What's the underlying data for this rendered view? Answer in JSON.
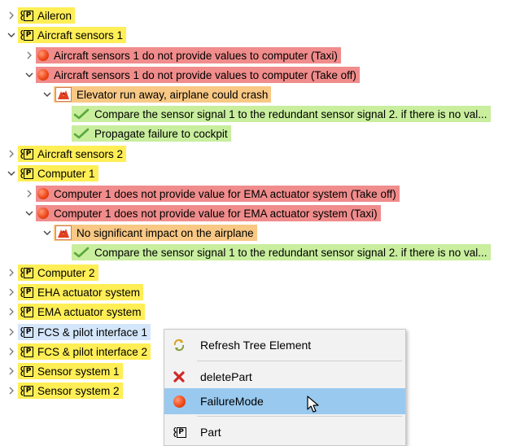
{
  "colors": {
    "part_highlight": "#ffee55",
    "failure_mode_highlight": "#f08c8c",
    "effect_highlight": "#f8c884",
    "measure_highlight": "#c8ee9e",
    "selected_row": "#d4e6fb",
    "menu_selected": "#99c9ef"
  },
  "tree": {
    "aileron": "Aileron",
    "aircraft_sensors_1": "Aircraft sensors 1",
    "as1_fm_taxi": "Aircraft sensors 1 do not provide values to computer (Taxi)",
    "as1_fm_takeoff": "Aircraft sensors 1 do not provide values to computer (Take off)",
    "as1_effect": "Elevator run away, airplane could crash",
    "as1_measure_compare": "Compare the sensor signal 1 to the redundant sensor signal 2. if there is no val...",
    "as1_measure_propagate": "Propagate failure to cockpit",
    "aircraft_sensors_2": "Aircraft sensors 2",
    "computer_1": "Computer 1",
    "c1_fm_takeoff": "Computer 1 does not provide value for EMA actuator system (Take off)",
    "c1_fm_taxi": "Computer 1 does not provide value for EMA actuator system (Taxi)",
    "c1_effect": "No significant impact on the airplane",
    "c1_measure_compare": "Compare the sensor signal 1 to the redundant sensor signal 2. if there is no val...",
    "computer_2": "Computer 2",
    "eha": "EHA actuator system",
    "ema": "EMA actuator system",
    "fcs1": "FCS & pilot interface 1",
    "fcs2": "FCS & pilot interface 2",
    "sensor_system_1": "Sensor system 1",
    "sensor_system_2": "Sensor system 2"
  },
  "part_icon_letter": "P",
  "context_menu": {
    "refresh": "Refresh Tree Element",
    "delete_part": "deletePart",
    "failure_mode": "FailureMode",
    "part": "Part"
  },
  "icons": {
    "refresh": "refresh-arrows-icon",
    "delete": "red-x-icon",
    "failure_mode": "red-ball-icon",
    "part": "part-P-icon",
    "effect": "hazard-icon",
    "measure": "green-check-icon"
  }
}
